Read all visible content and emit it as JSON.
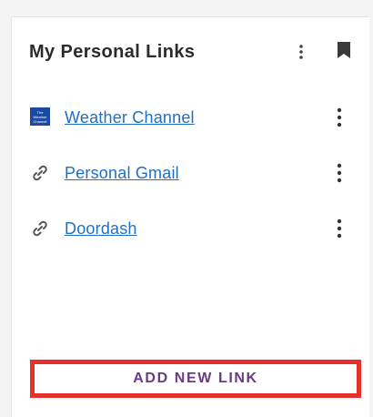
{
  "widget": {
    "title": "My Personal Links",
    "header_menu_icon": "vertical-ellipsis-icon",
    "bookmark_icon": "bookmark-icon"
  },
  "links": [
    {
      "label": "Weather Channel",
      "icon": "weather-channel-logo",
      "logo_text": "The Weather Channel"
    },
    {
      "label": "Personal Gmail",
      "icon": "link-icon"
    },
    {
      "label": "Doordash",
      "icon": "link-icon"
    }
  ],
  "actions": {
    "add_label": "ADD NEW LINK",
    "highlight_color": "#e8302a",
    "label_color": "#6b3a86"
  },
  "colors": {
    "link": "#1f6fc2",
    "logo_bg": "#1c4aa3"
  }
}
